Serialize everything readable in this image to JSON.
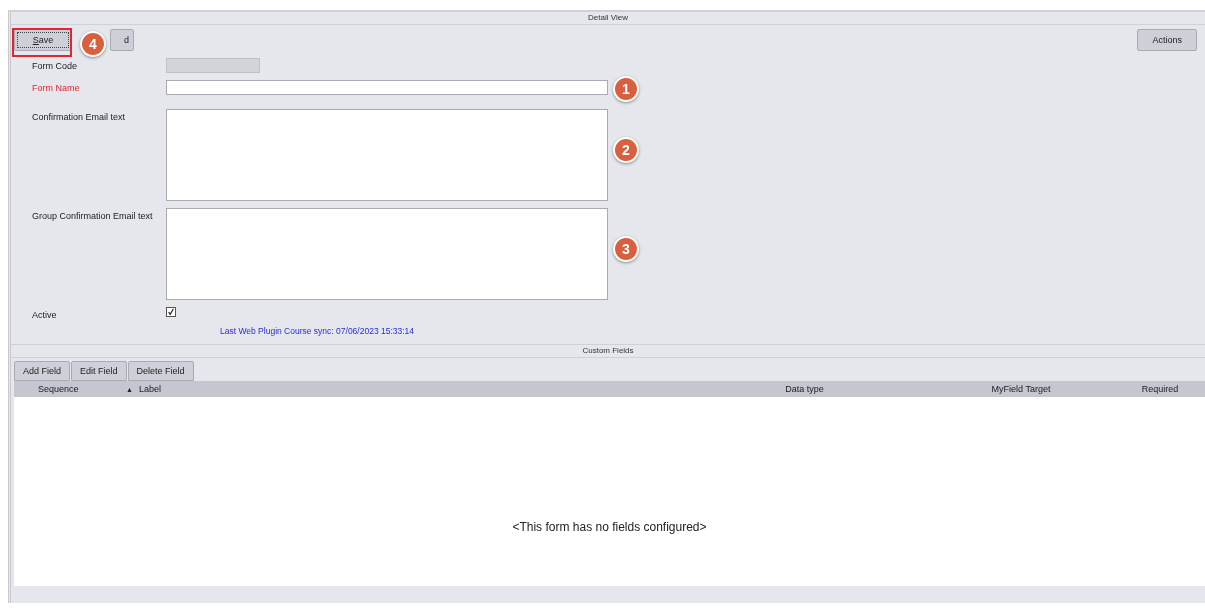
{
  "detail_view": {
    "title": "Detail View",
    "toolbar": [
      {
        "label": "Save",
        "focused": true
      },
      {
        "label": "d",
        "focused": false
      }
    ],
    "actions_button": "Actions"
  },
  "form": {
    "fields": [
      {
        "kind": "disabled",
        "label": "Form Code",
        "required": false
      },
      {
        "kind": "text",
        "label": "Form Name",
        "required": true,
        "badge": "1"
      },
      {
        "kind": "textarea",
        "label": "Confirmation Email text",
        "required": false,
        "badge": "2"
      },
      {
        "kind": "textarea",
        "label": "Group Confirmation Email text",
        "required": false,
        "badge": "3"
      }
    ],
    "active": {
      "label": "Active",
      "checked": true
    },
    "sync_text": "Last Web Plugin Course sync: 07/06/2023 15:33:14"
  },
  "save_badge": "4",
  "custom_fields": {
    "title": "Custom Fields",
    "buttons": [
      "Add Field",
      "Edit Field",
      "Delete Field"
    ],
    "columns": [
      {
        "label": "Sequence"
      },
      {
        "label": "Label",
        "sort_icon": "▲"
      },
      {
        "label": "Data type"
      },
      {
        "label": "MyField Target"
      },
      {
        "label": "Required"
      }
    ],
    "empty_message": "<This form has no fields configured>"
  }
}
